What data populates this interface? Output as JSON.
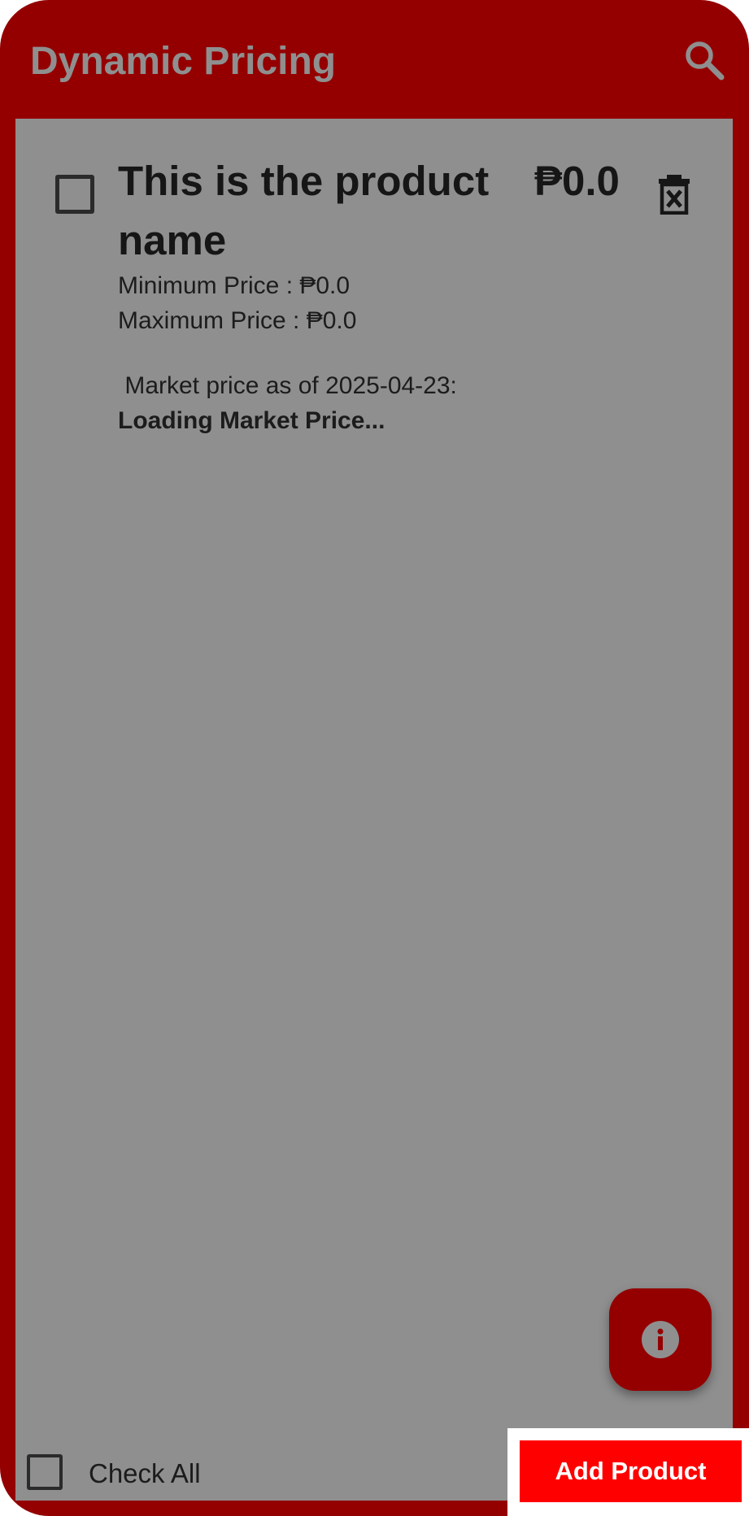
{
  "app_bar": {
    "title": "Dynamic Pricing",
    "search_icon": "search-icon"
  },
  "product": {
    "name": "This is the product name",
    "price": "₱0.0",
    "min_price": "Minimum Price : ₱0.0",
    "max_price": "Maximum Price : ₱0.0",
    "market_price_label": " Market price as of 2025-04-23:",
    "market_price_status": "Loading Market Price...",
    "checked": false,
    "delete_icon": "delete-x-icon"
  },
  "fab": {
    "icon": "info-icon"
  },
  "footer": {
    "check_all_label": "Check All",
    "add_product_label": "Add Product"
  },
  "colors": {
    "frame": "#940000",
    "content_bg": "#8f8f8f",
    "title_text": "#8f8f8f",
    "add_button": "#ff0000"
  }
}
